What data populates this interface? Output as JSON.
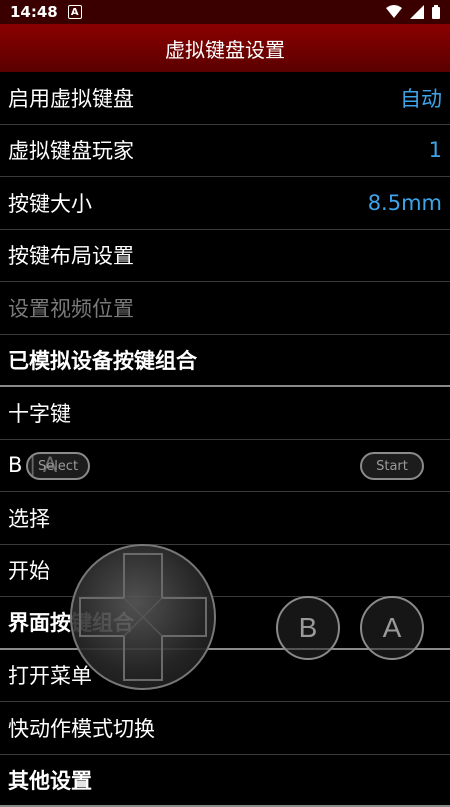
{
  "status": {
    "time": "14:48",
    "badge": "A"
  },
  "title": "虚拟键盘设置",
  "items": [
    {
      "label": "启用虚拟键盘",
      "value": "自动"
    },
    {
      "label": "虚拟键盘玩家",
      "value": "1"
    },
    {
      "label": "按键大小",
      "value": "8.5mm"
    },
    {
      "label": "按键布局设置"
    },
    {
      "label": "设置视频位置"
    },
    {
      "label": "已模拟设备按键组合"
    },
    {
      "label": "十字键"
    },
    {
      "label": "B | A"
    },
    {
      "label": "选择"
    },
    {
      "label": "开始"
    },
    {
      "label": "界面按键组合"
    },
    {
      "label": "打开菜单"
    },
    {
      "label": "快动作模式切换"
    },
    {
      "label": "其他设置"
    }
  ],
  "overlay": {
    "select_label": "Select",
    "start_label": "Start",
    "b_label": "B",
    "a_label": "A"
  },
  "colors": {
    "accent": "#3ea4ea",
    "titlebar": "#7a0000",
    "statusbar": "#3a0000"
  }
}
